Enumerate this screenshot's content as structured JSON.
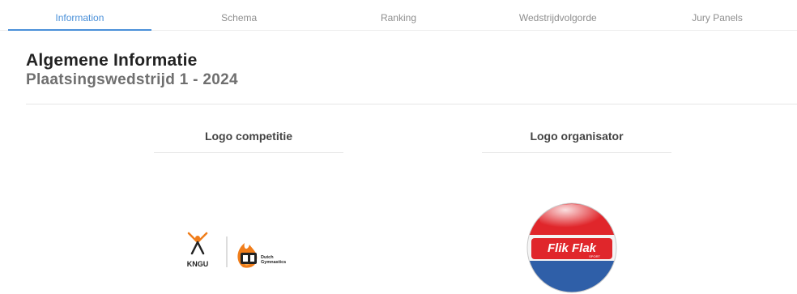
{
  "tabs": [
    {
      "label": "Information",
      "active": true
    },
    {
      "label": "Schema"
    },
    {
      "label": "Ranking"
    },
    {
      "label": "Wedstrijdvolgorde"
    },
    {
      "label": "Jury Panels"
    }
  ],
  "header": {
    "title": "Algemene Informatie",
    "subtitle": "Plaatsingswedstrijd 1 - 2024"
  },
  "logos": {
    "competition_label": "Logo competitie",
    "organizer_label": "Logo organisator",
    "kngu_text": "KNGU",
    "dutch_gym_line1": "Dutch",
    "dutch_gym_line2": "Gymnastics",
    "flik_text": "Flik Flak",
    "flik_sub": "SPORT"
  },
  "colors": {
    "accent": "#4a90d9",
    "kngu_orange": "#f07d1a",
    "flik_red": "#e0262b",
    "flik_blue": "#2f5fa8"
  }
}
